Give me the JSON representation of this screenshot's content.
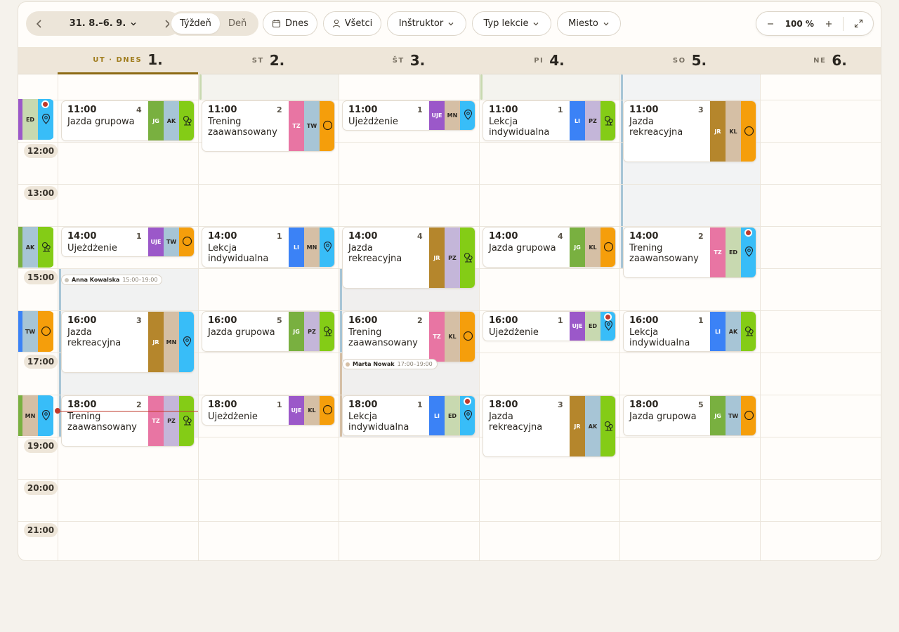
{
  "toolbar": {
    "prev_icon": "chevron-left-icon",
    "next_icon": "chevron-right-icon",
    "date_range": "31. 8.–6. 9.",
    "view_week": "Týždeň",
    "view_day": "Deň",
    "today_btn": "Dnes",
    "all_btn": "Všetci",
    "instructor_filter": "Inštruktor",
    "lesson_type_filter": "Typ lekcie",
    "place_filter": "Miesto",
    "zoom_value": "100 %"
  },
  "days": [
    {
      "name": "UT · DNES",
      "num": "1.",
      "today": true
    },
    {
      "name": "ST",
      "num": "2."
    },
    {
      "name": "ŠT",
      "num": "3."
    },
    {
      "name": "PI",
      "num": "4."
    },
    {
      "name": "SO",
      "num": "5."
    },
    {
      "name": "NE",
      "num": "6."
    }
  ],
  "times": [
    "12:00",
    "13:00",
    "15:00",
    "17:00",
    "19:00",
    "20:00",
    "21:00"
  ],
  "availability": [
    {
      "name": "Anna Kowalska",
      "time": "15:00–19:00"
    },
    {
      "name": "Marta Nowak",
      "time": "17:00–19:00"
    }
  ],
  "strip_colors": {
    "JG": "#79b040",
    "AK": "#a7c5d6",
    "TW": "#a7c5d6",
    "TZ": "#e875a3",
    "UJE": "#9b58c9",
    "MN": "#d5bfa5",
    "LI": "#3b82f6",
    "PZ": "#c4b6d9",
    "JR": "#b5862c",
    "KL": "#d5bfa5",
    "ED": "#c8d9b0",
    "loc_tree": "#84cc16",
    "loc_pin": "#38bdf8",
    "loc_ring": "#f59e0b"
  },
  "partial_col": [
    {
      "slot": 0,
      "codes": [
        "ED"
      ],
      "loc": "pin",
      "dot": true
    },
    {
      "slot": 3,
      "codes": [
        "AK"
      ],
      "loc": "tree"
    },
    {
      "slot": 5,
      "codes": [
        "TW"
      ],
      "loc": "ring"
    },
    {
      "slot": 7,
      "codes": [
        "MN"
      ],
      "loc": "pin"
    }
  ],
  "events": [
    {
      "day": 0,
      "start": 11,
      "dur": 1,
      "time": "11:00",
      "count": "4",
      "name": "Jazda grupowa",
      "codes": [
        "JG",
        "AK"
      ],
      "loc": "tree"
    },
    {
      "day": 1,
      "start": 11,
      "dur": 1.25,
      "time": "11:00",
      "count": "2",
      "name": "Trening zaawansowany",
      "codes": [
        "TZ",
        "TW"
      ],
      "loc": "ring"
    },
    {
      "day": 2,
      "start": 11,
      "dur": 0.75,
      "time": "11:00",
      "count": "1",
      "name": "Ujeżdżenie",
      "codes": [
        "UJE",
        "MN"
      ],
      "loc": "pin"
    },
    {
      "day": 3,
      "start": 11,
      "dur": 1,
      "time": "11:00",
      "count": "1",
      "name": "Lekcja indywidualna",
      "codes": [
        "LI",
        "PZ"
      ],
      "loc": "tree"
    },
    {
      "day": 4,
      "start": 11,
      "dur": 1.5,
      "time": "11:00",
      "count": "3",
      "name": "Jazda rekreacyjna",
      "codes": [
        "JR",
        "KL"
      ],
      "loc": "ring"
    },
    {
      "day": 0,
      "start": 14,
      "dur": 0.75,
      "time": "14:00",
      "count": "1",
      "name": "Ujeżdżenie",
      "codes": [
        "UJE",
        "TW"
      ],
      "loc": "ring"
    },
    {
      "day": 1,
      "start": 14,
      "dur": 1,
      "time": "14:00",
      "count": "1",
      "name": "Lekcja indywidualna",
      "codes": [
        "LI",
        "MN"
      ],
      "loc": "pin"
    },
    {
      "day": 2,
      "start": 14,
      "dur": 1.5,
      "time": "14:00",
      "count": "4",
      "name": "Jazda rekreacyjna",
      "codes": [
        "JR",
        "PZ"
      ],
      "loc": "tree"
    },
    {
      "day": 3,
      "start": 14,
      "dur": 1,
      "time": "14:00",
      "count": "4",
      "name": "Jazda grupowa",
      "codes": [
        "JG",
        "KL"
      ],
      "loc": "ring"
    },
    {
      "day": 4,
      "start": 14,
      "dur": 1.25,
      "time": "14:00",
      "count": "2",
      "name": "Trening zaawansowany",
      "codes": [
        "TZ",
        "ED"
      ],
      "loc": "pin",
      "dot": true
    },
    {
      "day": 0,
      "start": 16,
      "dur": 1.5,
      "time": "16:00",
      "count": "3",
      "name": "Jazda rekreacyjna",
      "codes": [
        "JR",
        "MN"
      ],
      "loc": "pin"
    },
    {
      "day": 1,
      "start": 16,
      "dur": 1,
      "time": "16:00",
      "count": "5",
      "name": "Jazda grupowa",
      "codes": [
        "JG",
        "PZ"
      ],
      "loc": "tree"
    },
    {
      "day": 2,
      "start": 16,
      "dur": 1.25,
      "time": "16:00",
      "count": "2",
      "name": "Trening zaawansowany",
      "codes": [
        "TZ",
        "KL"
      ],
      "loc": "ring"
    },
    {
      "day": 3,
      "start": 16,
      "dur": 0.75,
      "time": "16:00",
      "count": "1",
      "name": "Ujeżdżenie",
      "codes": [
        "UJE",
        "ED"
      ],
      "loc": "pin",
      "dot": true
    },
    {
      "day": 4,
      "start": 16,
      "dur": 1,
      "time": "16:00",
      "count": "1",
      "name": "Lekcja indywidualna",
      "codes": [
        "LI",
        "AK"
      ],
      "loc": "tree"
    },
    {
      "day": 0,
      "start": 18,
      "dur": 1.25,
      "time": "18:00",
      "count": "2",
      "name": "Trening zaawansowany",
      "codes": [
        "TZ",
        "PZ"
      ],
      "loc": "tree"
    },
    {
      "day": 1,
      "start": 18,
      "dur": 0.75,
      "time": "18:00",
      "count": "1",
      "name": "Ujeżdżenie",
      "codes": [
        "UJE",
        "KL"
      ],
      "loc": "ring"
    },
    {
      "day": 2,
      "start": 18,
      "dur": 1,
      "time": "18:00",
      "count": "1",
      "name": "Lekcja indywidualna",
      "codes": [
        "LI",
        "ED"
      ],
      "loc": "pin",
      "dot": true
    },
    {
      "day": 3,
      "start": 18,
      "dur": 1.5,
      "time": "18:00",
      "count": "3",
      "name": "Jazda rekreacyjna",
      "codes": [
        "JR",
        "AK"
      ],
      "loc": "tree"
    },
    {
      "day": 4,
      "start": 18,
      "dur": 1,
      "time": "18:00",
      "count": "5",
      "name": "Jazda grupowa",
      "codes": [
        "JG",
        "TW"
      ],
      "loc": "ring"
    }
  ]
}
